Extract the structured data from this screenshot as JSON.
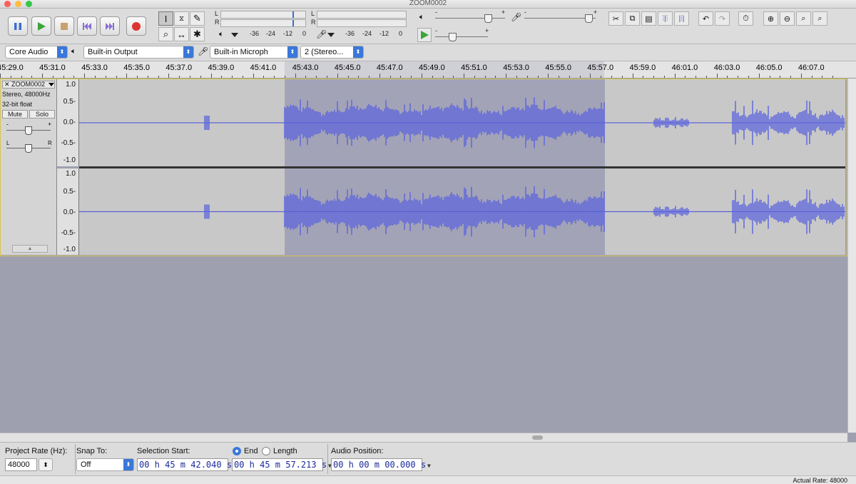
{
  "window": {
    "title": "ZOOM0002"
  },
  "transport": {
    "pause": "pause-icon",
    "play": "play-icon",
    "stop": "stop-icon",
    "skip_start": "skip-start-icon",
    "skip_end": "skip-end-icon",
    "record": "record-icon"
  },
  "meters": {
    "play_ticks": [
      "-36",
      "-24",
      "-12",
      "0"
    ],
    "rec_ticks": [
      "-36",
      "-24",
      "-12",
      "0"
    ],
    "left_label": "L",
    "right_label": "R"
  },
  "mixer": {
    "minus": "-",
    "plus": "+"
  },
  "device": {
    "host": "Core Audio",
    "output": "Built-in Output",
    "input": "Built-in Microph",
    "channels": "2 (Stereo..."
  },
  "ruler": {
    "labels": [
      "45:29.0",
      "45:31.0",
      "45:33.0",
      "45:35.0",
      "45:37.0",
      "45:39.0",
      "45:41.0",
      "45:43.0",
      "45:45.0",
      "45:47.0",
      "45:49.0",
      "45:51.0",
      "45:53.0",
      "45:55.0",
      "45:57.0",
      "45:59.0",
      "46:01.0",
      "46:03.0",
      "46:05.0",
      "46:07.0"
    ]
  },
  "track": {
    "name": "ZOOM0002",
    "info1": "Stereo, 48000Hz",
    "info2": "32-bit float",
    "mute": "Mute",
    "solo": "Solo",
    "gain_minus": "-",
    "gain_plus": "+",
    "pan_l": "L",
    "pan_r": "R",
    "scale": [
      "1.0",
      "0.5-",
      "0.0-",
      "-0.5-",
      "-1.0"
    ]
  },
  "selection": {
    "rate_label": "Project Rate (Hz):",
    "rate_value": "48000",
    "snap_label": "Snap To:",
    "snap_value": "Off",
    "start_label": "Selection Start:",
    "start_value": "00 h 45 m 42.040 s",
    "end_label": "End",
    "length_label": "Length",
    "end_value": "00 h 45 m 57.213 s",
    "pos_label": "Audio Position:",
    "pos_value": "00 h 00 m 00.000 s"
  },
  "status": {
    "actual_rate": "Actual Rate: 48000"
  }
}
